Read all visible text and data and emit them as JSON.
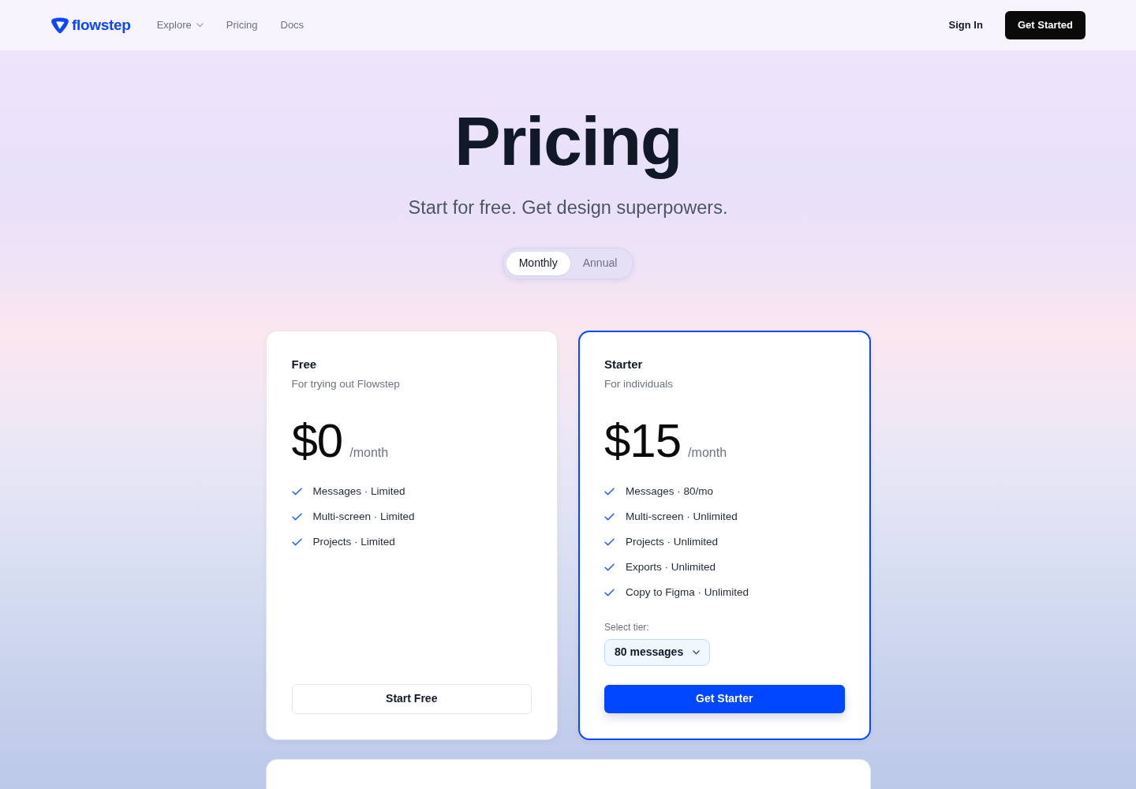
{
  "nav": {
    "brand": "flowstep",
    "links": [
      {
        "label": "Explore",
        "has_menu": true
      },
      {
        "label": "Pricing",
        "has_menu": false
      },
      {
        "label": "Docs",
        "has_menu": false
      }
    ],
    "sign_in": "Sign In",
    "cta": "Get Started"
  },
  "hero": {
    "title": "Pricing",
    "subtitle": "Start for free. Get design superpowers."
  },
  "billing": [
    {
      "label": "Monthly",
      "selected": true
    },
    {
      "label": "Annual",
      "selected": false
    }
  ],
  "plans": [
    {
      "name": "Free",
      "tagline": "For trying out Flowstep",
      "price": "$0",
      "period": "/month",
      "features": [
        "Messages · Limited",
        "Multi-screen · Limited",
        "Projects · Limited"
      ],
      "button": "Start Free",
      "highlighted": false
    },
    {
      "name": "Starter",
      "tagline": "For individuals",
      "price": "$15",
      "period": "/month",
      "features": [
        "Messages · 80/mo",
        "Multi-screen · Unlimited",
        "Projects · Unlimited",
        "Exports · Unlimited",
        "Copy to Figma · Unlimited"
      ],
      "tier": {
        "label": "Select tier:",
        "value": "80 messages"
      },
      "button": "Get Starter",
      "highlighted": true
    }
  ]
}
